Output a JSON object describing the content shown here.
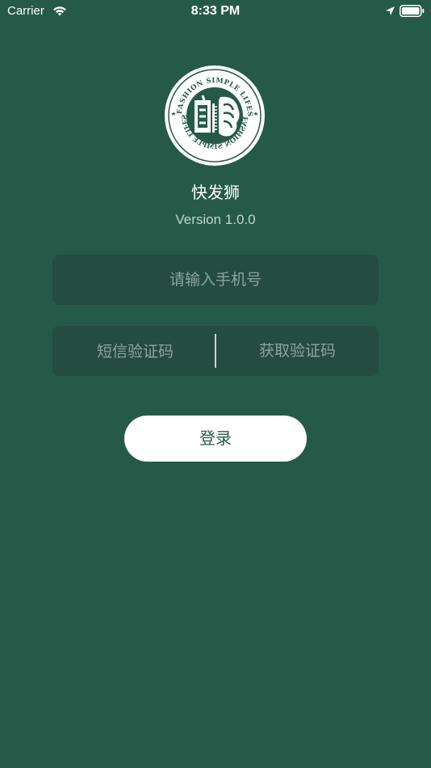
{
  "status_bar": {
    "carrier": "Carrier",
    "time": "8:33 PM",
    "icons": [
      "wifi-icon",
      "location-icon",
      "battery-icon"
    ]
  },
  "logo": {
    "top_text": "FAST FASHION SIMPLE LIFESTYLE",
    "bottom_text": "FAST FASHION SIMPLE LIFESTYLE",
    "icon": "lion-logo-icon"
  },
  "app": {
    "name": "快发狮",
    "version": "Version 1.0.0"
  },
  "form": {
    "phone_placeholder": "请输入手机号",
    "phone_value": "",
    "code_placeholder": "短信验证码",
    "code_value": "",
    "get_code_label": "获取验证码",
    "login_label": "登录"
  },
  "colors": {
    "background": "#255a49",
    "field_background": "#244c40",
    "placeholder": "#8aa59c",
    "button_background": "#ffffff",
    "button_text": "#255a49"
  }
}
